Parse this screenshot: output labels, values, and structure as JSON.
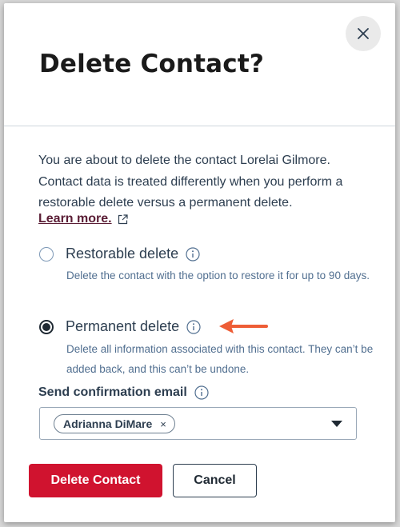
{
  "dialog": {
    "title": "Delete Contact?",
    "description": "You are about to delete the contact Lorelai Gilmore. Contact data is treated differently when you perform a restorable delete versus a permanent delete.",
    "learn_more_label": "Learn more.",
    "external_icon": "external-link-icon",
    "close_icon": "close-icon"
  },
  "options": [
    {
      "label": "Restorable delete",
      "help": "Delete the contact with the option to restore it for up to 90 days.",
      "checked": false
    },
    {
      "label": "Permanent delete",
      "help": "Delete all information associated with this contact. They can’t be added back, and this can’t be undone.",
      "checked": true
    }
  ],
  "email": {
    "label": "Send confirmation email",
    "recipients": [
      "Adrianna DiMare"
    ],
    "remove_glyph": "×"
  },
  "buttons": {
    "primary": "Delete Contact",
    "secondary": "Cancel"
  },
  "colors": {
    "primary_button": "#d0132f",
    "link": "#5a1d35",
    "annotation_arrow": "#ee5d36"
  }
}
